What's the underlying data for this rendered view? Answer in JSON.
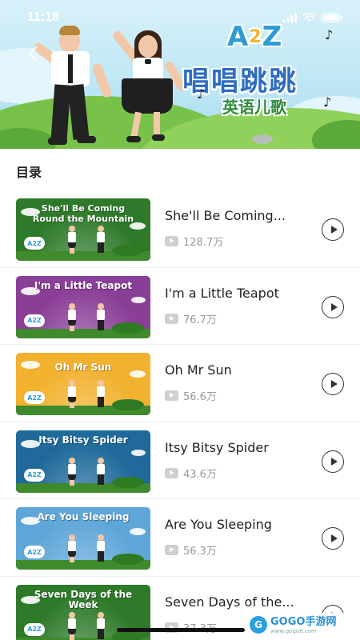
{
  "status_bar": {
    "time": "11:18"
  },
  "banner": {
    "logo_text_a": "A",
    "logo_text_2": "2",
    "logo_text_z": "Z",
    "title": "唱唱跳跳",
    "subtitle": "英语儿歌",
    "note_glyph": "♪"
  },
  "catalog": {
    "title": "目录",
    "items": [
      {
        "thumb_title": "She'll Be Coming Round the Mountain",
        "title": "She'll Be Coming...",
        "plays": "128.7万",
        "color": "#2e7a2a"
      },
      {
        "thumb_title": "I'm a Little Teapot",
        "title": "I'm a Little Teapot",
        "plays": "76.7万",
        "color": "#8a3f97"
      },
      {
        "thumb_title": "Oh Mr Sun",
        "title": "Oh Mr Sun",
        "plays": "56.6万",
        "color": "#f2b12f"
      },
      {
        "thumb_title": "Itsy Bitsy Spider",
        "title": "Itsy Bitsy Spider",
        "plays": "43.6万",
        "color": "#1f6a9a"
      },
      {
        "thumb_title": "Are You Sleeping",
        "title": "Are You Sleeping",
        "plays": "56.3万",
        "color": "#5fa6d8"
      },
      {
        "thumb_title": "Seven Days of the Week",
        "title": "Seven Days of the...",
        "plays": "37.3万",
        "color": "#2e7a2a"
      }
    ]
  },
  "thumb_logo": "A2Z",
  "watermark": {
    "badge": "G",
    "main": "GOGO手游网",
    "sub": "www.gogo8.com"
  }
}
